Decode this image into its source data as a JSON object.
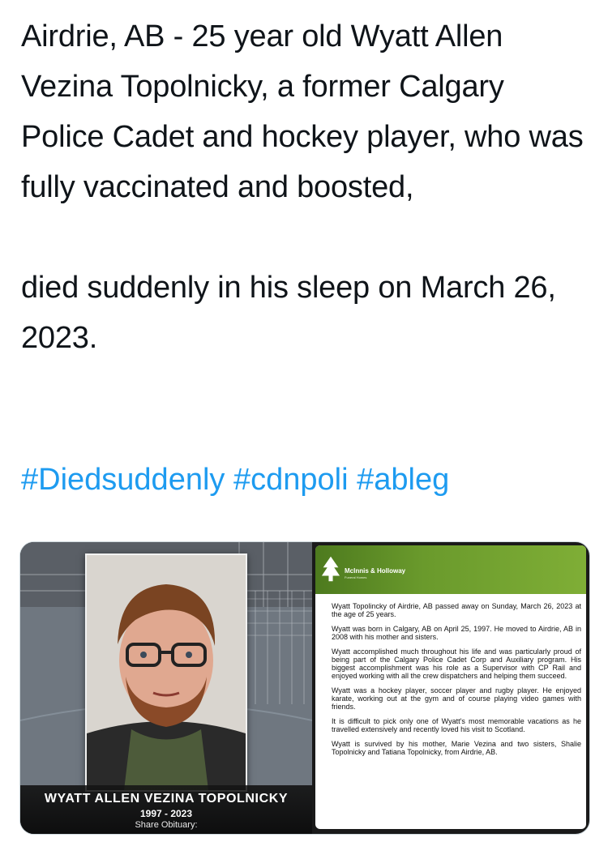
{
  "tweet": {
    "line1": "Airdrie, AB - 25 year old Wyatt Allen Vezina Topolnicky, a former Calgary Police Cadet and hockey player, who was fully vaccinated and boosted,",
    "line2": "died suddenly in his sleep on March 26, 2023.",
    "hashtags": [
      "#Diedsuddenly",
      "#cdnpoli",
      "#ableg"
    ],
    "link_color": "#1d9bf0"
  },
  "card": {
    "name": "WYATT ALLEN VEZINA TOPOLNICKY",
    "years": "1997 - 2023",
    "share": "Share Obituary:",
    "brand": "McInnis & Holloway",
    "brand_sub": "Funeral Homes",
    "header_color": "#6a9a2c",
    "paragraphs": [
      "Wyatt Topolincky of Airdrie, AB passed away on Sunday, March 26, 2023 at the age of 25 years.",
      "Wyatt was born in Calgary, AB on April 25, 1997. He moved to Airdrie, AB in 2008 with his mother and sisters.",
      "Wyatt accomplished much throughout his life and was particularly proud of being part of the Calgary Police Cadet Corp and Auxiliary program. His biggest accomplishment was his role as a Supervisor with CP Rail and enjoyed working with all the crew dispatchers and helping them succeed.",
      "Wyatt was a hockey player, soccer player and rugby player. He enjoyed karate, working out at the gym and of course playing video games with friends.",
      "It is difficult to pick only one of Wyatt's most memorable vacations as he travelled extensively and recently loved his visit to Scotland.",
      "Wyatt is survived by his mother, Marie Vezina and two sisters, Shalie Topolnicky and Tatiana Topolnicky, from Airdrie, AB."
    ]
  }
}
